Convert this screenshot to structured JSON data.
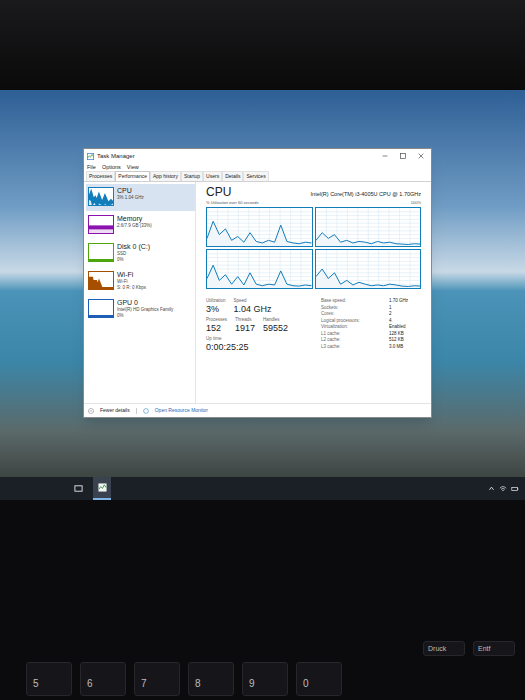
{
  "window": {
    "title": "Task Manager"
  },
  "menu": [
    "File",
    "Options",
    "View"
  ],
  "tabs": [
    {
      "label": "Processes",
      "selected": false
    },
    {
      "label": "Performance",
      "selected": true
    },
    {
      "label": "App history",
      "selected": false
    },
    {
      "label": "Startup",
      "selected": false
    },
    {
      "label": "Users",
      "selected": false
    },
    {
      "label": "Details",
      "selected": false
    },
    {
      "label": "Services",
      "selected": false
    }
  ],
  "sidebar": {
    "items": [
      {
        "name": "CPU",
        "lines": [
          "3% 1.04 GHz"
        ],
        "selected": true,
        "color": "#117dbb",
        "values": [
          30,
          60,
          20,
          35,
          10,
          45,
          15,
          10,
          40,
          12,
          8,
          20,
          10
        ]
      },
      {
        "name": "Memory",
        "lines": [
          "2.6/7.9 GB (33%)"
        ],
        "selected": false,
        "color": "#8b12ae",
        "values": [
          33,
          33,
          33,
          33,
          33,
          33,
          33,
          33,
          33,
          33,
          33,
          33,
          33
        ]
      },
      {
        "name": "Disk 0 (C:)",
        "lines": [
          "SSD",
          "0%"
        ],
        "selected": false,
        "color": "#4da60c",
        "values": [
          0,
          0,
          0,
          0,
          0,
          0,
          0,
          0,
          0,
          0,
          0,
          0,
          0
        ]
      },
      {
        "name": "Wi-Fi",
        "lines": [
          "Wi-Fi",
          "S: 0 R: 0 Kbps"
        ],
        "selected": false,
        "color": "#a74f01",
        "values": [
          0,
          70,
          0,
          50,
          0,
          30,
          0,
          0,
          0,
          0,
          0,
          0,
          0
        ]
      },
      {
        "name": "GPU 0",
        "lines": [
          "Intel(R) HD Graphics Family",
          "0%"
        ],
        "selected": false,
        "color": "#1c5fb5",
        "values": [
          0,
          0,
          0,
          0,
          0,
          0,
          0,
          0,
          0,
          0,
          0,
          0,
          0
        ]
      }
    ]
  },
  "cpu": {
    "title": "CPU",
    "model": "Intel(R) Core(TM) i3-4005U CPU @ 1.70GHz",
    "graph_label": "% Utilization over 60 seconds",
    "graph_max": "100%",
    "cores": [
      {
        "values": [
          20,
          65,
          30,
          45,
          15,
          25,
          10,
          35,
          12,
          8,
          15,
          10,
          55,
          12,
          8,
          6,
          10,
          8
        ]
      },
      {
        "values": [
          15,
          35,
          20,
          30,
          10,
          15,
          8,
          12,
          10,
          6,
          12,
          8,
          10,
          6,
          5,
          4,
          6,
          5
        ]
      },
      {
        "values": [
          25,
          60,
          20,
          35,
          10,
          30,
          8,
          40,
          10,
          6,
          10,
          8,
          45,
          10,
          6,
          5,
          8,
          6
        ]
      },
      {
        "values": [
          30,
          50,
          25,
          40,
          10,
          20,
          8,
          15,
          10,
          6,
          8,
          6,
          10,
          8,
          5,
          4,
          6,
          5
        ]
      }
    ],
    "stats": [
      [
        {
          "label": "Utilization",
          "value": "3%"
        },
        {
          "label": "Speed",
          "value": "1.04 GHz"
        }
      ],
      [
        {
          "label": "Processes",
          "value": "152"
        },
        {
          "label": "Threads",
          "value": "1917"
        },
        {
          "label": "Handles",
          "value": "59552"
        }
      ],
      [
        {
          "label": "Up time",
          "value": "0:00:25:25"
        }
      ]
    ],
    "specs": [
      {
        "label": "Base speed:",
        "value": "1.70 GHz"
      },
      {
        "label": "Sockets:",
        "value": "1"
      },
      {
        "label": "Cores:",
        "value": "2"
      },
      {
        "label": "Logical processors:",
        "value": "4"
      },
      {
        "label": "Virtualization:",
        "value": "Enabled"
      },
      {
        "label": "L1 cache:",
        "value": "128 KB"
      },
      {
        "label": "L2 cache:",
        "value": "512 KB"
      },
      {
        "label": "L3 cache:",
        "value": "3.0 MB"
      }
    ]
  },
  "footer": {
    "fewer_details": "Fewer details",
    "resource_monitor": "Open Resource Monitor"
  },
  "keyboard": {
    "function_keys": [
      "Druck",
      "Entf"
    ],
    "number_keys": [
      "5",
      "6",
      "7",
      "8",
      "9",
      "0"
    ]
  }
}
